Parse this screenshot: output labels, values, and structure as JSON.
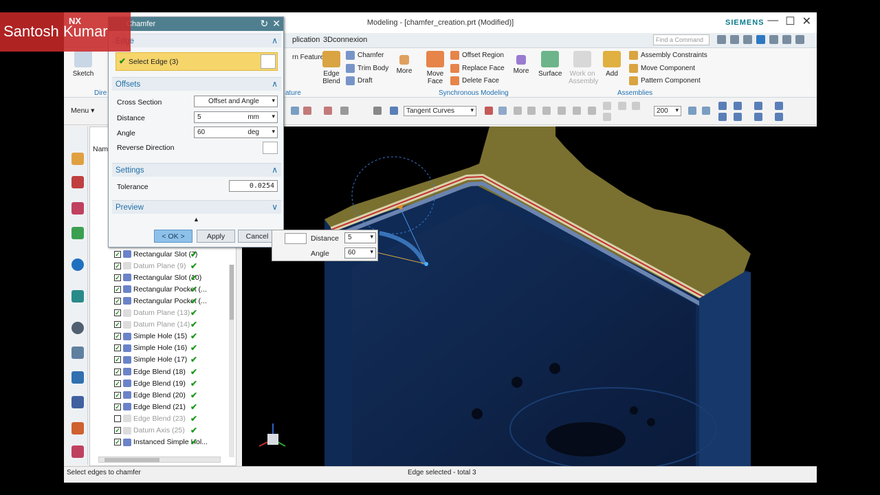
{
  "window": {
    "title": "Modeling - [chamfer_creation.prt (Modified)]",
    "brand": "SIEMENS",
    "controls": [
      "—",
      "☐",
      "✕"
    ]
  },
  "menubar": {
    "items": [
      "plication",
      "3Dconnexion"
    ],
    "find_placeholder": "Find a Command"
  },
  "ribbon": {
    "sketch_label": "Sketch",
    "direct_label": "Dire",
    "pattern_feature": "rn Feature",
    "edge_blend": "Edge Blend",
    "chamfer": "Chamfer",
    "trim_body": "Trim Body",
    "draft": "Draft",
    "more1": "More",
    "feature_group": "ature",
    "move_face": "Move Face",
    "offset_region": "Offset Region",
    "replace_face": "Replace Face",
    "delete_face": "Delete Face",
    "more2": "More",
    "sync_group": "Synchronous Modeling",
    "surface": "Surface",
    "work_on_assembly": "Work on Assembly",
    "add": "Add",
    "assembly_constraints": "Assembly Constraints",
    "move_component": "Move Component",
    "pattern_component": "Pattern Component",
    "assemblies_group": "Assemblies"
  },
  "toolbar": {
    "menu_label": "Menu ▾",
    "filter_value": "Tangent Curves",
    "zoom_value": "200"
  },
  "navigator": {
    "header_partial": "Nam",
    "rows": [
      {
        "label": "Rectangular Slot (7)",
        "checked": true,
        "dim": false,
        "ok": true
      },
      {
        "label": "Datum Plane (9)",
        "checked": true,
        "dim": true,
        "ok": true
      },
      {
        "label": "Rectangular Slot (10)",
        "checked": true,
        "dim": false,
        "ok": true
      },
      {
        "label": "Rectangular Pocket (...",
        "checked": true,
        "dim": false,
        "ok": true
      },
      {
        "label": "Rectangular Pocket (...",
        "checked": true,
        "dim": false,
        "ok": true
      },
      {
        "label": "Datum Plane (13)",
        "checked": true,
        "dim": true,
        "ok": true
      },
      {
        "label": "Datum Plane (14)",
        "checked": true,
        "dim": true,
        "ok": true
      },
      {
        "label": "Simple Hole (15)",
        "checked": true,
        "dim": false,
        "ok": true
      },
      {
        "label": "Simple Hole (16)",
        "checked": true,
        "dim": false,
        "ok": true
      },
      {
        "label": "Simple Hole (17)",
        "checked": true,
        "dim": false,
        "ok": true
      },
      {
        "label": "Edge Blend (18)",
        "checked": true,
        "dim": false,
        "ok": true
      },
      {
        "label": "Edge Blend (19)",
        "checked": true,
        "dim": false,
        "ok": true
      },
      {
        "label": "Edge Blend (20)",
        "checked": true,
        "dim": false,
        "ok": true
      },
      {
        "label": "Edge Blend (21)",
        "checked": true,
        "dim": false,
        "ok": true
      },
      {
        "label": "Edge Blend (23)",
        "checked": false,
        "dim": true,
        "ok": true
      },
      {
        "label": "Datum Axis (25)",
        "checked": true,
        "dim": true,
        "ok": true
      },
      {
        "label": "Instanced Simple Hol...",
        "checked": true,
        "dim": false,
        "ok": true
      }
    ]
  },
  "dialog": {
    "title": "Chamfer",
    "edge_section": "Edge",
    "select_edge": "Select Edge (3)",
    "offsets_section": "Offsets",
    "cross_section_label": "Cross Section",
    "cross_section_value": "Offset and Angle",
    "distance_label": "Distance",
    "distance_value": "5",
    "distance_unit": "mm",
    "angle_label": "Angle",
    "angle_value": "60",
    "angle_unit": "deg",
    "reverse_label": "Reverse Direction",
    "settings_section": "Settings",
    "tolerance_label": "Tolerance",
    "tolerance_value": "0.0254",
    "preview_section": "Preview",
    "ok_label": "< OK >",
    "apply_label": "Apply",
    "cancel_label": "Cancel"
  },
  "float_input": {
    "distance_label": "Distance",
    "distance_value": "5",
    "angle_label": "Angle",
    "angle_value": "60"
  },
  "status": {
    "left": "Select edges to chamfer",
    "center": "Edge selected - total 3"
  },
  "watermark": {
    "text": "Santosh Kumar",
    "app_badge": "NX"
  }
}
